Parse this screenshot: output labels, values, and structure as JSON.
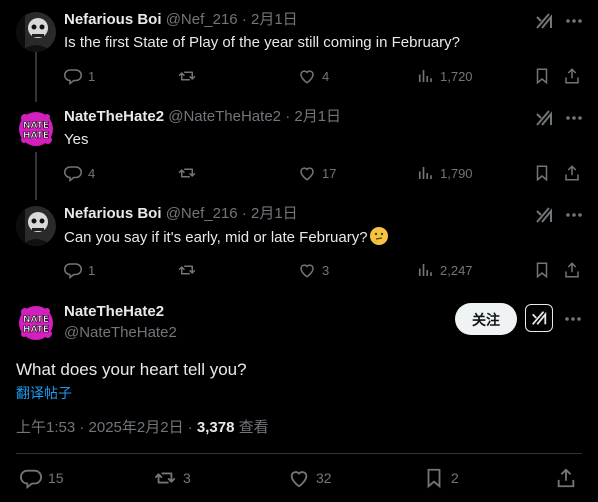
{
  "replies": [
    {
      "name": "Nefarious Boi",
      "handle": "@Nef_216",
      "sep": "·",
      "date": "2月1日",
      "text": "Is the first State of Play of the year still coming in February?",
      "replies": "1",
      "reposts": "",
      "likes": "4",
      "views": "1,720"
    },
    {
      "name": "NateTheHate2",
      "handle": "@NateTheHate2",
      "sep": "·",
      "date": "2月1日",
      "text": "Yes",
      "replies": "4",
      "reposts": "",
      "likes": "17",
      "views": "1,790"
    },
    {
      "name": "Nefarious Boi",
      "handle": "@Nef_216",
      "sep": "·",
      "date": "2月1日",
      "text": "Can you say if it's early, mid or late February?",
      "emoji": "thinking-face",
      "replies": "1",
      "reposts": "",
      "likes": "3",
      "views": "2,247"
    }
  ],
  "main_post": {
    "name": "NateTheHate2",
    "handle": "@NateTheHate2",
    "follow_label": "关注",
    "text": "What does your heart tell you?",
    "translate_label": "翻译帖子",
    "time": "上午1:53 · 2025年2月2日 · ",
    "views_count": "3,378",
    "views_label": " 查看",
    "replies": "15",
    "reposts": "3",
    "likes": "32",
    "bookmarks": "2"
  },
  "icons": {
    "reply": "reply-icon",
    "repost": "repost-icon",
    "like": "heart-icon",
    "views": "views-chart-icon",
    "bookmark": "bookmark-icon",
    "share": "share-icon",
    "grok": "grok-icon",
    "more": "more-dots-icon"
  },
  "colors": {
    "background": "#000000",
    "text": "#e7e9ea",
    "muted": "#71767b",
    "link": "#1d9bf0",
    "follow_bg": "#eff3f4",
    "avatar_nate": "#d21fbd"
  }
}
